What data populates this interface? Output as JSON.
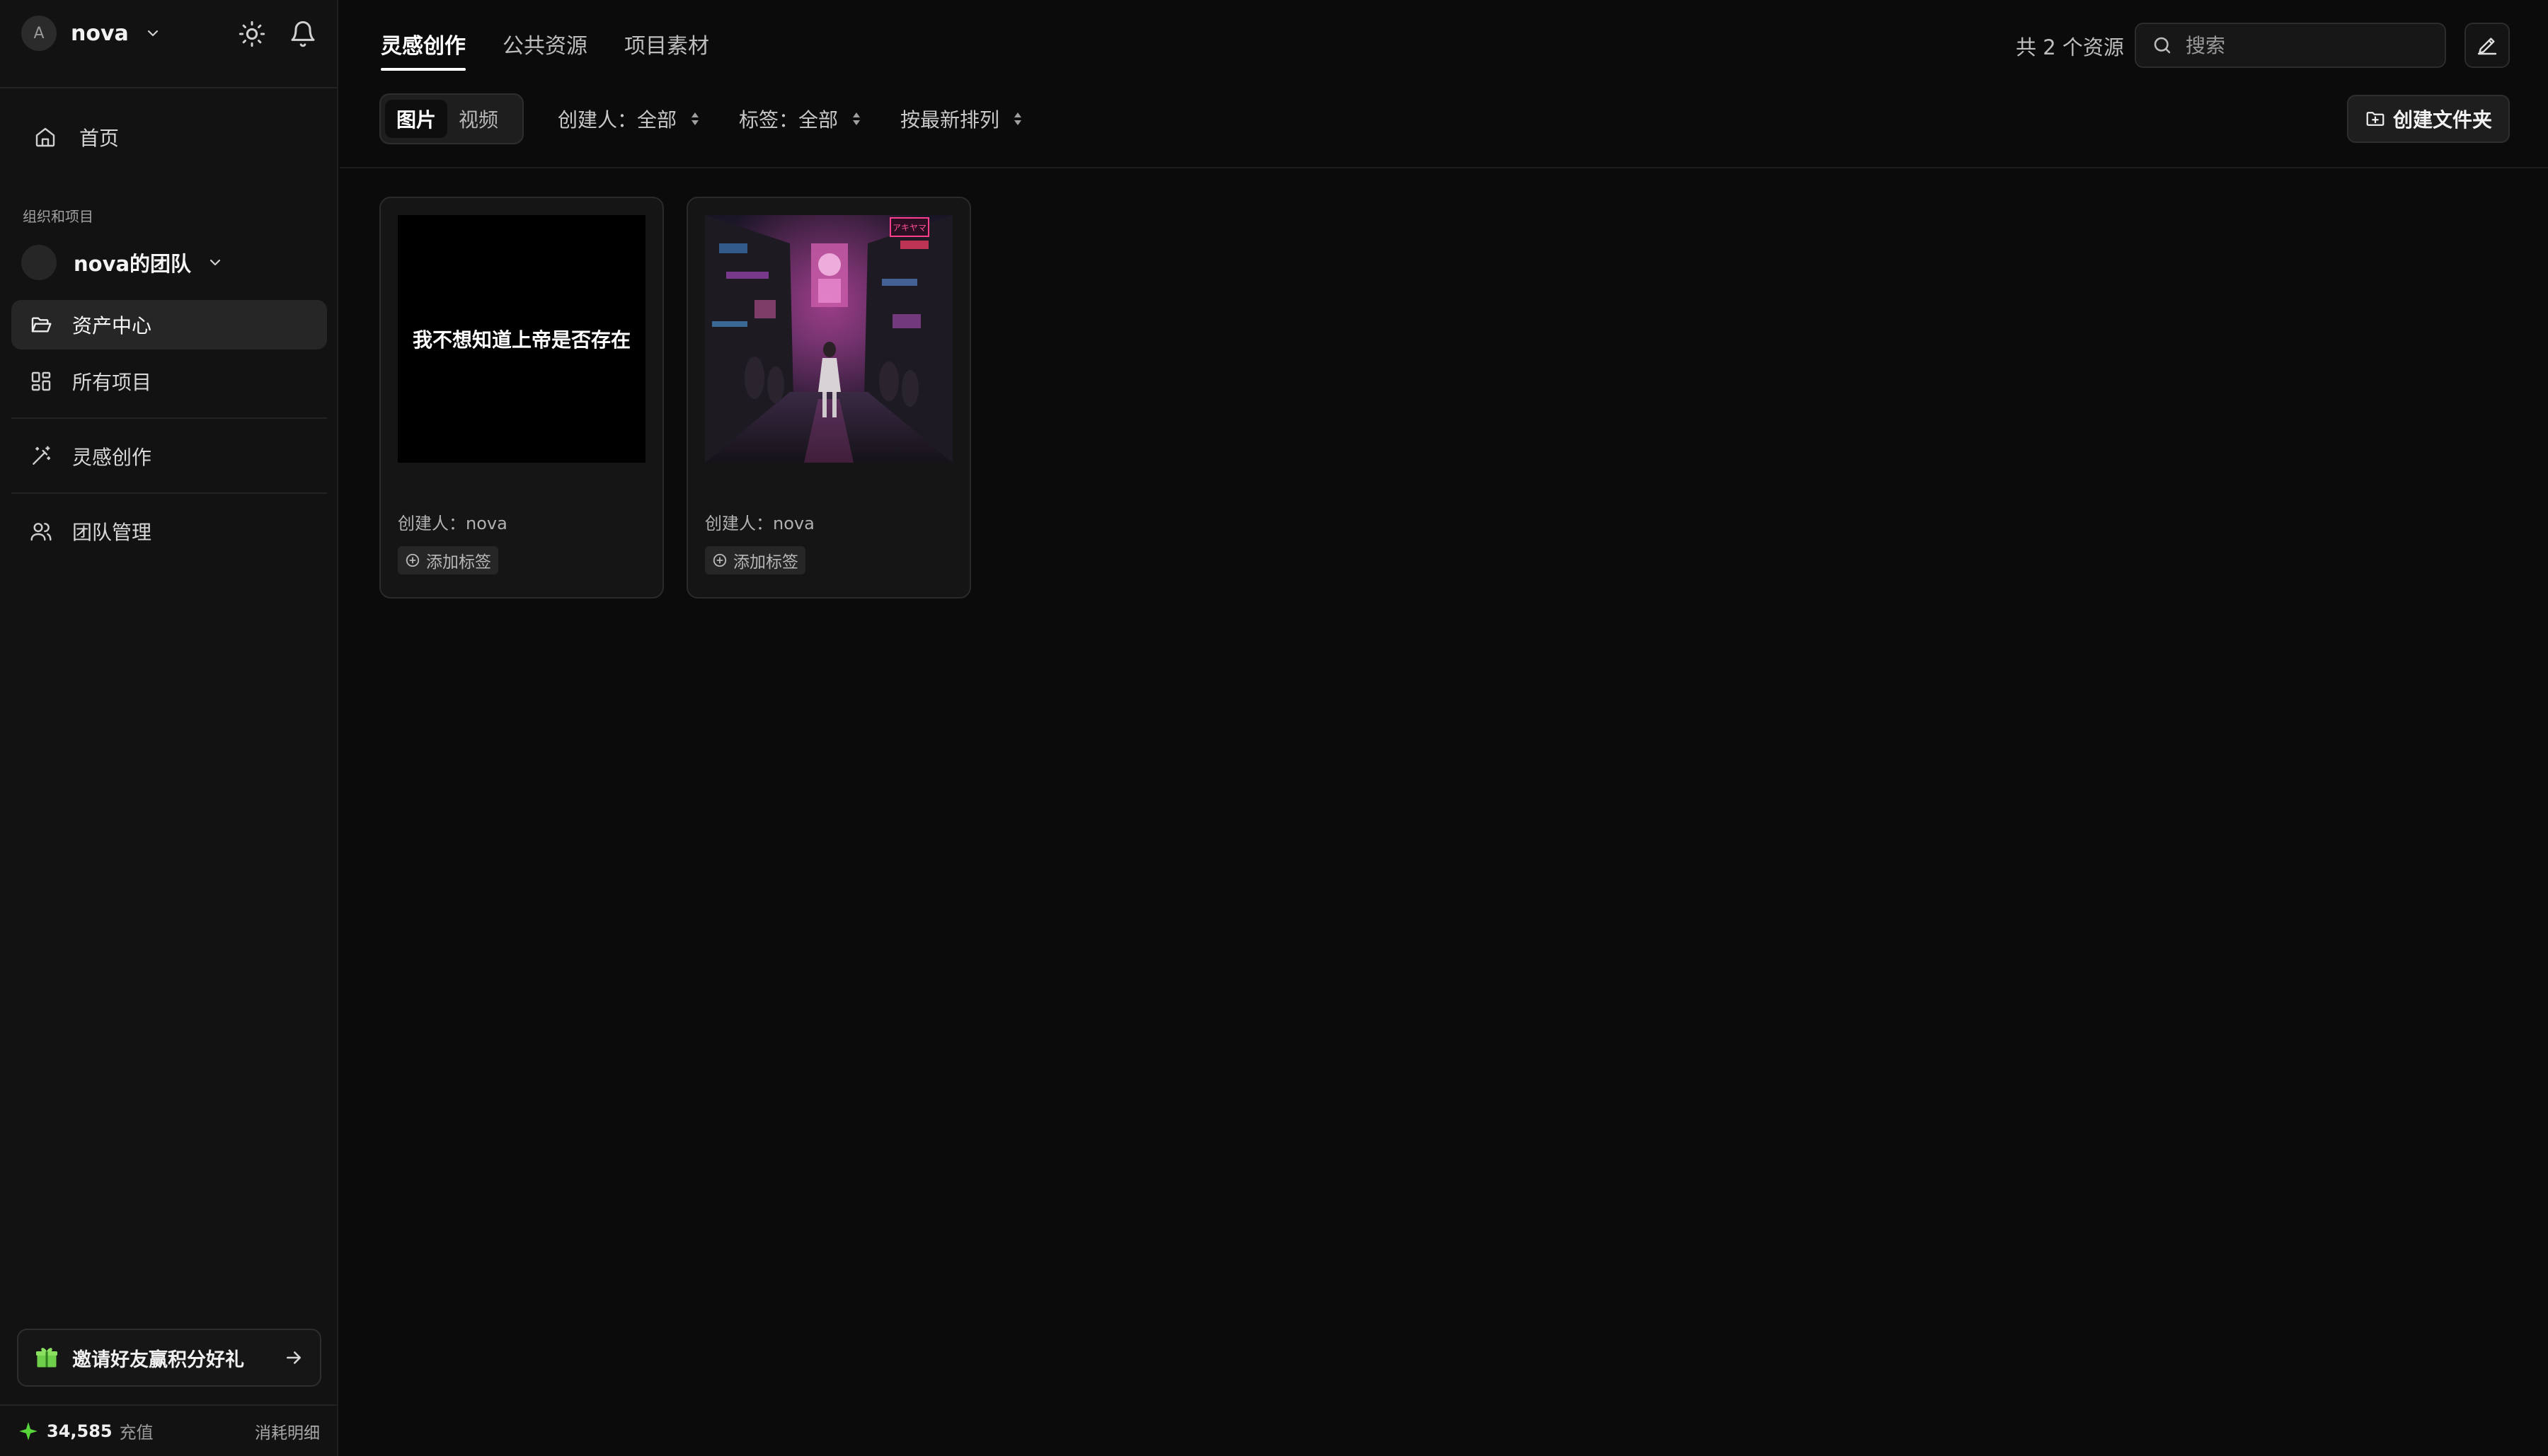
{
  "user": {
    "initial": "A",
    "name": "nova"
  },
  "sidebar": {
    "home_label": "首页",
    "section_title": "组织和项目",
    "team_name": "nova的团队",
    "items": [
      {
        "label": "资产中心",
        "icon": "folder-open-icon",
        "active": true
      },
      {
        "label": "所有项目",
        "icon": "grid-icon",
        "active": false
      },
      {
        "label": "灵感创作",
        "icon": "magic-wand-icon",
        "active": false
      },
      {
        "label": "团队管理",
        "icon": "users-icon",
        "active": false
      }
    ],
    "invite_label": "邀请好友赢积分好礼",
    "credits": "34,585",
    "recharge_label": "充值",
    "usage_label": "消耗明细"
  },
  "header": {
    "tabs": [
      "灵感创作",
      "公共资源",
      "项目素材"
    ],
    "active_tab": 0,
    "resource_count": "共 2 个资源",
    "search_placeholder": "搜索"
  },
  "toolbar": {
    "media_types": [
      "图片",
      "视频"
    ],
    "active_media": 0,
    "creator_filter": "创建人：全部",
    "tag_filter": "标签：全部",
    "sort": "按最新排列",
    "create_folder_label": "创建文件夹"
  },
  "assets": [
    {
      "thumb_text": "我不想知道上帝是否存在",
      "creator": "创建人：nova",
      "tag_label": "添加标签"
    },
    {
      "thumb_text": "",
      "thumb_sign": "アキヤマ",
      "creator": "创建人：nova",
      "tag_label": "添加标签"
    }
  ],
  "colors": {
    "background": "#0b0b0b",
    "sidebar": "#121212",
    "credit_star": "#57d63a",
    "gift": "#7ed957"
  }
}
